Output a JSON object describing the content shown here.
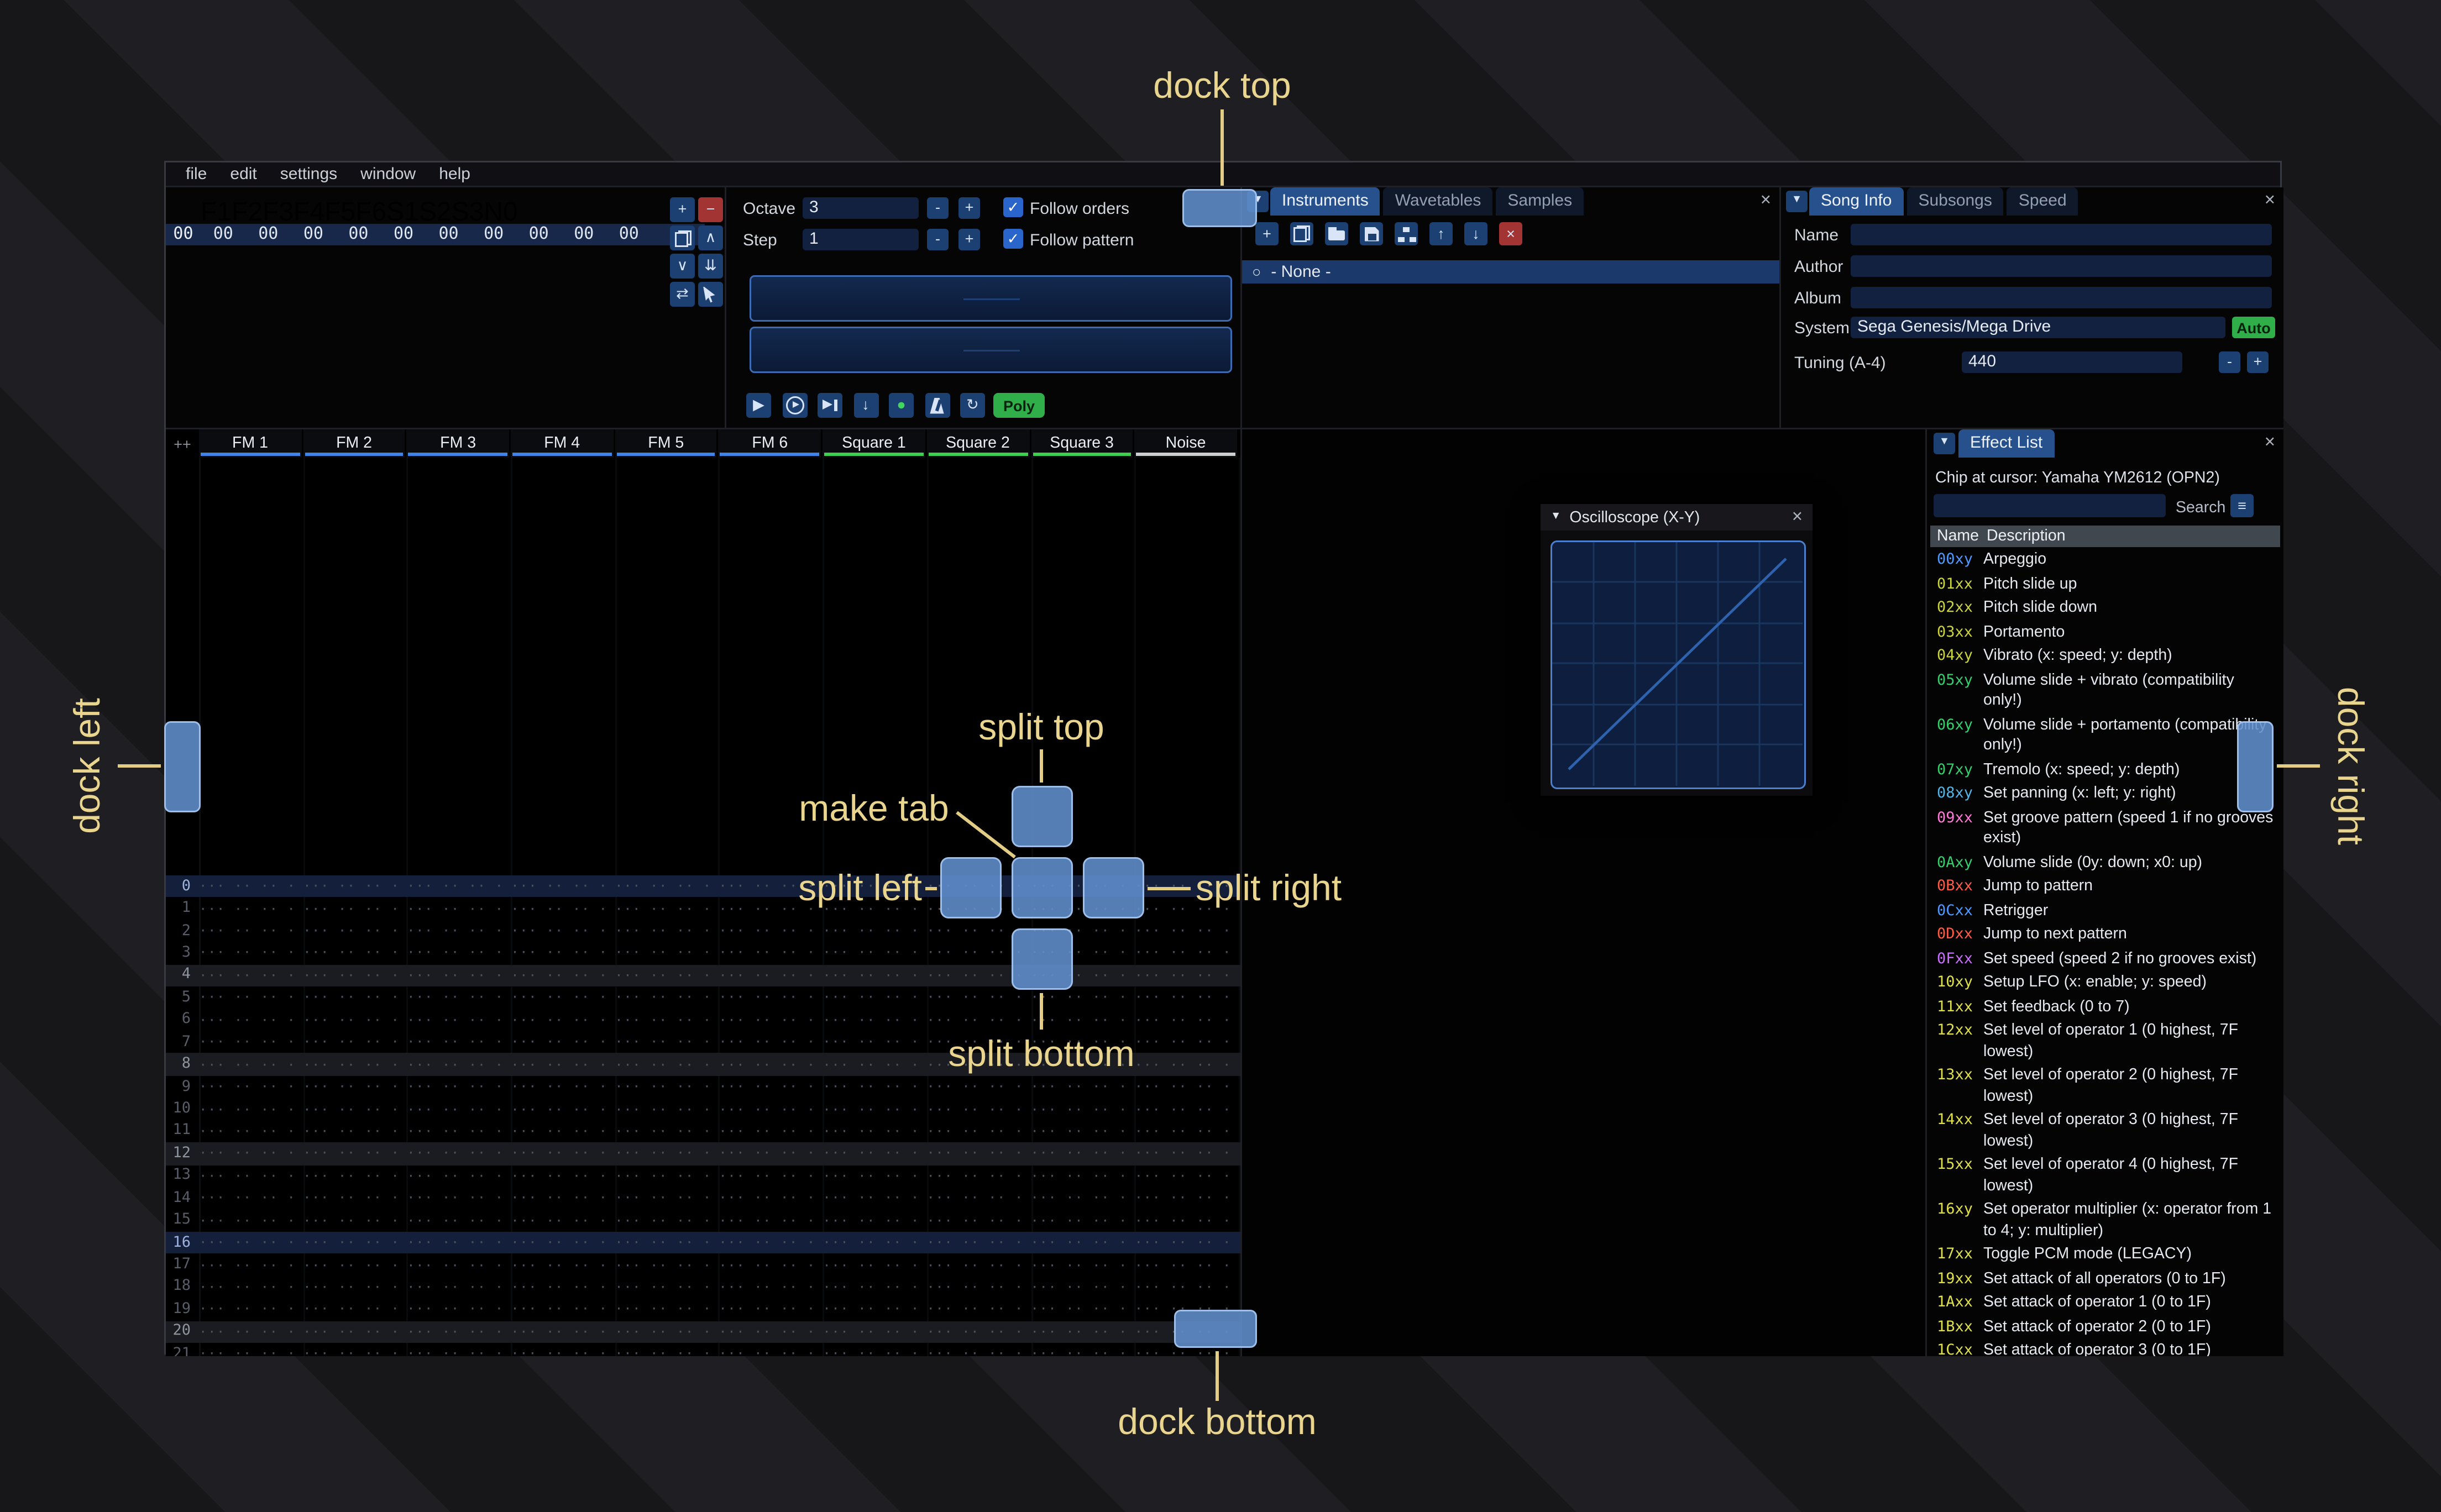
{
  "app": {
    "menu": [
      "file",
      "edit",
      "settings",
      "window",
      "help"
    ]
  },
  "ui": {
    "close": "×",
    "dropdown": "▼",
    "collapse": "▼",
    "check": "✓",
    "radio": "○",
    "menu_icon": "≡",
    "corner": "++"
  },
  "orders": {
    "columns": [
      "F1",
      "F2",
      "F3",
      "F4",
      "F5",
      "F6",
      "S1",
      "S2",
      "S3",
      "N0"
    ],
    "row": {
      "index": "00",
      "values": [
        "00",
        "00",
        "00",
        "00",
        "00",
        "00",
        "00",
        "00",
        "00",
        "00"
      ]
    },
    "buttons": [
      {
        "name": "add-order-button",
        "glyph": "+"
      },
      {
        "name": "remove-order-button",
        "glyph": "−",
        "danger": true
      },
      {
        "name": "duplicate-order-button",
        "icon": "copy"
      },
      {
        "name": "move-order-up-button",
        "glyph": "∧"
      },
      {
        "name": "move-order-down-button",
        "glyph": "∨"
      },
      {
        "name": "duplicate-order-end-button",
        "glyph": "⇊"
      },
      {
        "name": "order-change-mode-button",
        "glyph": "⇄"
      },
      {
        "name": "order-edit-mode-button",
        "icon": "cursor"
      }
    ]
  },
  "controls": {
    "octave_label": "Octave",
    "octave_value": "3",
    "step_label": "Step",
    "step_value": "1",
    "minus": "-",
    "plus": "+",
    "follow_orders_label": "Follow orders",
    "follow_pattern_label": "Follow pattern",
    "transport": [
      {
        "name": "play-button",
        "glyph": "▶"
      },
      {
        "name": "play-pattern-button",
        "icon": "play-circle"
      },
      {
        "name": "play-row-button",
        "icon": "next"
      },
      {
        "name": "step-down-button",
        "glyph": "↓"
      },
      {
        "name": "edit-record-button",
        "glyph": "●",
        "color": "#43d65e"
      },
      {
        "name": "metronome-button",
        "icon": "metronome"
      },
      {
        "name": "repeat-button",
        "glyph": "↻"
      }
    ],
    "poly_label": "Poly"
  },
  "instruments": {
    "tabs": [
      "Instruments",
      "Wavetables",
      "Samples"
    ],
    "toolbar": [
      {
        "name": "add-instrument-button",
        "glyph": "+"
      },
      {
        "name": "duplicate-instrument-button",
        "icon": "copy"
      },
      {
        "name": "open-instrument-button",
        "icon": "folder"
      },
      {
        "name": "save-instrument-button",
        "icon": "floppy"
      },
      {
        "name": "instrument-folders-button",
        "icon": "sitemap"
      },
      {
        "name": "move-instrument-up-button",
        "glyph": "↑"
      },
      {
        "name": "move-instrument-down-button",
        "glyph": "↓"
      },
      {
        "name": "delete-instrument-button",
        "glyph": "×",
        "danger": true
      }
    ],
    "none_item": "- None -"
  },
  "song_info": {
    "tabs": [
      "Song Info",
      "Subsongs",
      "Speed"
    ],
    "name_label": "Name",
    "name_value": "",
    "author_label": "Author",
    "author_value": "",
    "album_label": "Album",
    "album_value": "",
    "system_label": "System",
    "system_value": "Sega Genesis/Mega Drive",
    "auto_label": "Auto",
    "tuning_label": "Tuning (A-4)",
    "tuning_value": "440"
  },
  "pattern": {
    "corner_label": "++",
    "row_count": 22,
    "empty_cell": "··· ·· ·· ···",
    "channels": [
      {
        "name": "FM 1",
        "color": "#3f84e8"
      },
      {
        "name": "FM 2",
        "color": "#3f84e8"
      },
      {
        "name": "FM 3",
        "color": "#3f84e8"
      },
      {
        "name": "FM 4",
        "color": "#3f84e8"
      },
      {
        "name": "FM 5",
        "color": "#3f84e8"
      },
      {
        "name": "FM 6",
        "color": "#3f84e8"
      },
      {
        "name": "Square 1",
        "color": "#3fcf4f"
      },
      {
        "name": "Square 2",
        "color": "#3fcf4f"
      },
      {
        "name": "Square 3",
        "color": "#3fcf4f"
      },
      {
        "name": "Noise",
        "color": "#cfcfcf"
      }
    ]
  },
  "oscilloscope": {
    "title": "Oscilloscope (X-Y)"
  },
  "effect_list": {
    "tab": "Effect List",
    "chip_line": "Chip at cursor: Yamaha YM2612 (OPN2)",
    "search_label": "Search",
    "search_value": "",
    "name_header": "Name",
    "desc_header": "Description",
    "effects": [
      {
        "code": "00xy",
        "color": "#4f9aff",
        "desc": "Arpeggio"
      },
      {
        "code": "01xx",
        "color": "#ccd53c",
        "desc": "Pitch slide up"
      },
      {
        "code": "02xx",
        "color": "#ccd53c",
        "desc": "Pitch slide down"
      },
      {
        "code": "03xx",
        "color": "#ccd53c",
        "desc": "Portamento"
      },
      {
        "code": "04xy",
        "color": "#ccd53c",
        "desc": "Vibrato (x: speed; y: depth)"
      },
      {
        "code": "05xy",
        "color": "#35d06e",
        "desc": "Volume slide + vibrato (compatibility only!)"
      },
      {
        "code": "06xy",
        "color": "#35d06e",
        "desc": "Volume slide + portamento (compatibility only!)"
      },
      {
        "code": "07xy",
        "color": "#35d06e",
        "desc": "Tremolo (x: speed; y: depth)"
      },
      {
        "code": "08xy",
        "color": "#53b4e8",
        "desc": "Set panning (x: left; y: right)"
      },
      {
        "code": "09xx",
        "color": "#ff7ad6",
        "desc": "Set groove pattern (speed 1 if no grooves exist)"
      },
      {
        "code": "0Axy",
        "color": "#35d06e",
        "desc": "Volume slide (0y: down; x0: up)"
      },
      {
        "code": "0Bxx",
        "color": "#ff5b45",
        "desc": "Jump to pattern"
      },
      {
        "code": "0Cxx",
        "color": "#4f9aff",
        "desc": "Retrigger"
      },
      {
        "code": "0Dxx",
        "color": "#ff5b45",
        "desc": "Jump to next pattern"
      },
      {
        "code": "0Fxx",
        "color": "#cb6dff",
        "desc": "Set speed (speed 2 if no grooves exist)"
      },
      {
        "code": "10xy",
        "color": "#e0e04a",
        "desc": "Setup LFO (x: enable; y: speed)"
      },
      {
        "code": "11xx",
        "color": "#e0e04a",
        "desc": "Set feedback (0 to 7)"
      },
      {
        "code": "12xx",
        "color": "#e0e04a",
        "desc": "Set level of operator 1 (0 highest, 7F lowest)"
      },
      {
        "code": "13xx",
        "color": "#e0e04a",
        "desc": "Set level of operator 2 (0 highest, 7F lowest)"
      },
      {
        "code": "14xx",
        "color": "#e0e04a",
        "desc": "Set level of operator 3 (0 highest, 7F lowest)"
      },
      {
        "code": "15xx",
        "color": "#e0e04a",
        "desc": "Set level of operator 4 (0 highest, 7F lowest)"
      },
      {
        "code": "16xy",
        "color": "#e0e04a",
        "desc": "Set operator multiplier (x: operator from 1 to 4; y: multiplier)"
      },
      {
        "code": "17xx",
        "color": "#e0e04a",
        "desc": "Toggle PCM mode (LEGACY)"
      },
      {
        "code": "19xx",
        "color": "#e0e04a",
        "desc": "Set attack of all operators (0 to 1F)"
      },
      {
        "code": "1Axx",
        "color": "#e0e04a",
        "desc": "Set attack of operator 1 (0 to 1F)"
      },
      {
        "code": "1Bxx",
        "color": "#e0e04a",
        "desc": "Set attack of operator 2 (0 to 1F)"
      },
      {
        "code": "1Cxx",
        "color": "#e0e04a",
        "desc": "Set attack of operator 3 (0 to 1F)"
      }
    ]
  },
  "overlay": {
    "dock_top": "dock top",
    "dock_bottom": "dock bottom",
    "dock_left": "dock left",
    "dock_right": "dock right",
    "split_top": "split top",
    "split_bottom": "split bottom",
    "split_left": "split left",
    "split_right": "split right",
    "make_tab": "make tab",
    "accent": "#e9d58e",
    "target_color": "#618fce"
  }
}
